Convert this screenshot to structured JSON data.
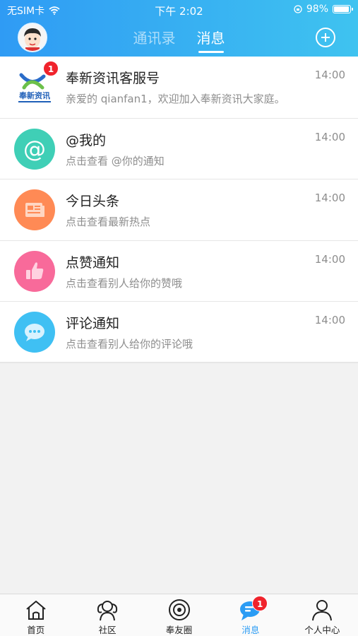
{
  "status_bar": {
    "carrier": "无SIM卡",
    "time": "下午 2:02",
    "battery": "98%"
  },
  "header": {
    "tabs": [
      {
        "label": "通讯录",
        "active": false
      },
      {
        "label": "消息",
        "active": true
      }
    ]
  },
  "messages": [
    {
      "title": "奉新资讯客服号",
      "subtitle": "亲爱的 qianfan1，欢迎加入奉新资讯大家庭。",
      "time": "14:00",
      "badge": "1",
      "icon": "fengxin-logo",
      "icon_color": "#ffffff"
    },
    {
      "title": "@我的",
      "subtitle": "点击查看 @你的通知",
      "time": "14:00",
      "icon": "at-icon",
      "icon_color": "#3fcfb6"
    },
    {
      "title": "今日头条",
      "subtitle": "点击查看最新热点",
      "time": "14:00",
      "icon": "newspaper-icon",
      "icon_color": "#ff8a55"
    },
    {
      "title": "点赞通知",
      "subtitle": "点击查看别人给你的赞哦",
      "time": "14:00",
      "icon": "thumbs-up-icon",
      "icon_color": "#f86a9a"
    },
    {
      "title": "评论通知",
      "subtitle": "点击查看别人给你的评论哦",
      "time": "14:00",
      "icon": "chat-bubble-icon",
      "icon_color": "#3fc0f3"
    }
  ],
  "logo_text": "奉新资讯",
  "tabbar": {
    "items": [
      {
        "label": "首页",
        "icon": "home-icon",
        "active": false
      },
      {
        "label": "社区",
        "icon": "community-icon",
        "active": false
      },
      {
        "label": "奉友圈",
        "icon": "circle-camera-icon",
        "active": false
      },
      {
        "label": "消息",
        "icon": "message-icon",
        "active": true,
        "badge": "1"
      },
      {
        "label": "个人中心",
        "icon": "person-icon",
        "active": false
      }
    ]
  },
  "colors": {
    "header_start": "#2f9bf4",
    "header_end": "#3fc3f0",
    "active_tab": "#2b9cf4",
    "badge": "#f0232c"
  }
}
